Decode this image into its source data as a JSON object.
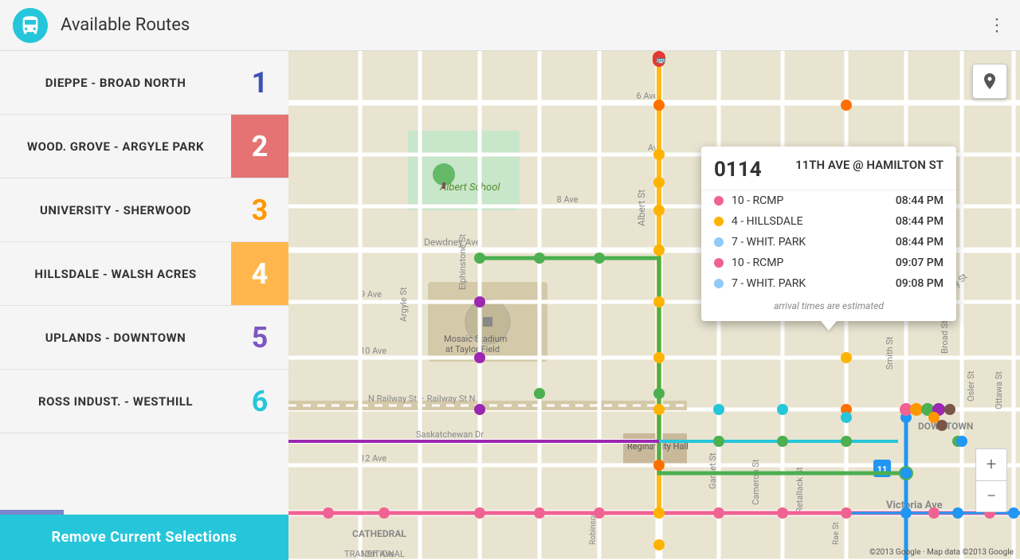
{
  "header": {
    "icon_label": "bus-icon",
    "title": "Available Routes",
    "menu_icon": "⋮"
  },
  "sidebar": {
    "routes": [
      {
        "id": 1,
        "label": "DIEPPE - BROAD NORTH",
        "number": "1",
        "number_style": "num-blue",
        "bg": ""
      },
      {
        "id": 2,
        "label": "WOOD. GROVE - ARGYLE PARK",
        "number": "2",
        "number_style": "num-orange-bg",
        "bg": ""
      },
      {
        "id": 3,
        "label": "UNIVERSITY - SHERWOOD",
        "number": "3",
        "number_style": "num-orange",
        "bg": ""
      },
      {
        "id": 4,
        "label": "HILLSDALE - WALSH ACRES",
        "number": "4",
        "number_style": "num-amber-bg",
        "bg": ""
      },
      {
        "id": 5,
        "label": "UPLANDS - DOWNTOWN",
        "number": "5",
        "number_style": "num-purple",
        "bg": ""
      },
      {
        "id": 6,
        "label": "ROSS INDUST. - WESTHILL",
        "number": "6",
        "number_style": "num-teal",
        "bg": ""
      }
    ],
    "bottom_button": "Remove Current Selections"
  },
  "popup": {
    "route_number": "0114",
    "route_name": "11TH AVE @ HAMILTON ST",
    "arrivals": [
      {
        "dot_color": "#f06292",
        "route": "10 - RCMP",
        "time": "08:44 PM"
      },
      {
        "dot_color": "#ffb300",
        "route": "4 - HILLSDALE",
        "time": "08:44 PM"
      },
      {
        "dot_color": "#90caf9",
        "route": "7 - WHIT. PARK",
        "time": "08:44 PM"
      },
      {
        "dot_color": "#f06292",
        "route": "10 - RCMP",
        "time": "09:07 PM"
      },
      {
        "dot_color": "#90caf9",
        "route": "7 - WHIT. PARK",
        "time": "09:08 PM"
      }
    ],
    "footer": "arrival times are estimated"
  },
  "map": {
    "attribution": "©2013 Google · Map data ©2013 Google"
  },
  "zoom": {
    "plus": "+",
    "minus": "−"
  }
}
